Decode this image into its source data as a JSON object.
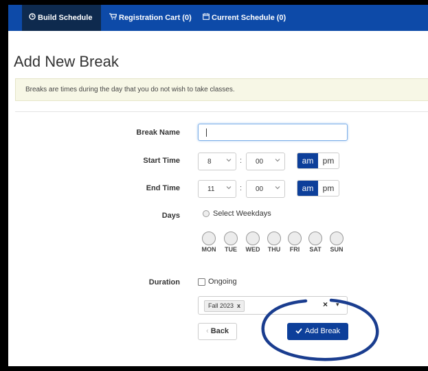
{
  "nav": {
    "tabs": [
      {
        "label": "Build Schedule",
        "icon": "clock-icon"
      },
      {
        "label": "Registration Cart (0)",
        "icon": "cart-icon"
      },
      {
        "label": "Current Schedule (0)",
        "icon": "calendar-icon"
      }
    ],
    "active_tab": 0
  },
  "page": {
    "title": "Add New Break",
    "info": "Breaks are times during the day that you do not wish to take classes."
  },
  "form": {
    "break_name": {
      "label": "Break Name",
      "value": ""
    },
    "start_time": {
      "label": "Start Time",
      "hour": "8",
      "minute": "00",
      "am": "am",
      "pm": "pm",
      "selected": "am"
    },
    "end_time": {
      "label": "End Time",
      "hour": "11",
      "minute": "00",
      "am": "am",
      "pm": "pm",
      "selected": "am"
    },
    "colon": ":",
    "days": {
      "label": "Days",
      "select_weekdays": "Select Weekdays",
      "items": [
        "MON",
        "TUE",
        "WED",
        "THU",
        "FRI",
        "SAT",
        "SUN"
      ]
    },
    "duration": {
      "label": "Duration",
      "ongoing": "Ongoing",
      "ongoing_checked": false,
      "terms": [
        "Fall 2023"
      ],
      "tag_remove": "x",
      "clear": "×"
    }
  },
  "buttons": {
    "back": "Back",
    "add": "Add Break"
  },
  "colors": {
    "nav_bg": "#0d4aa8",
    "nav_active": "#0e2a4e",
    "primary": "#0d3f9a",
    "annotation": "#1a3d8f"
  }
}
